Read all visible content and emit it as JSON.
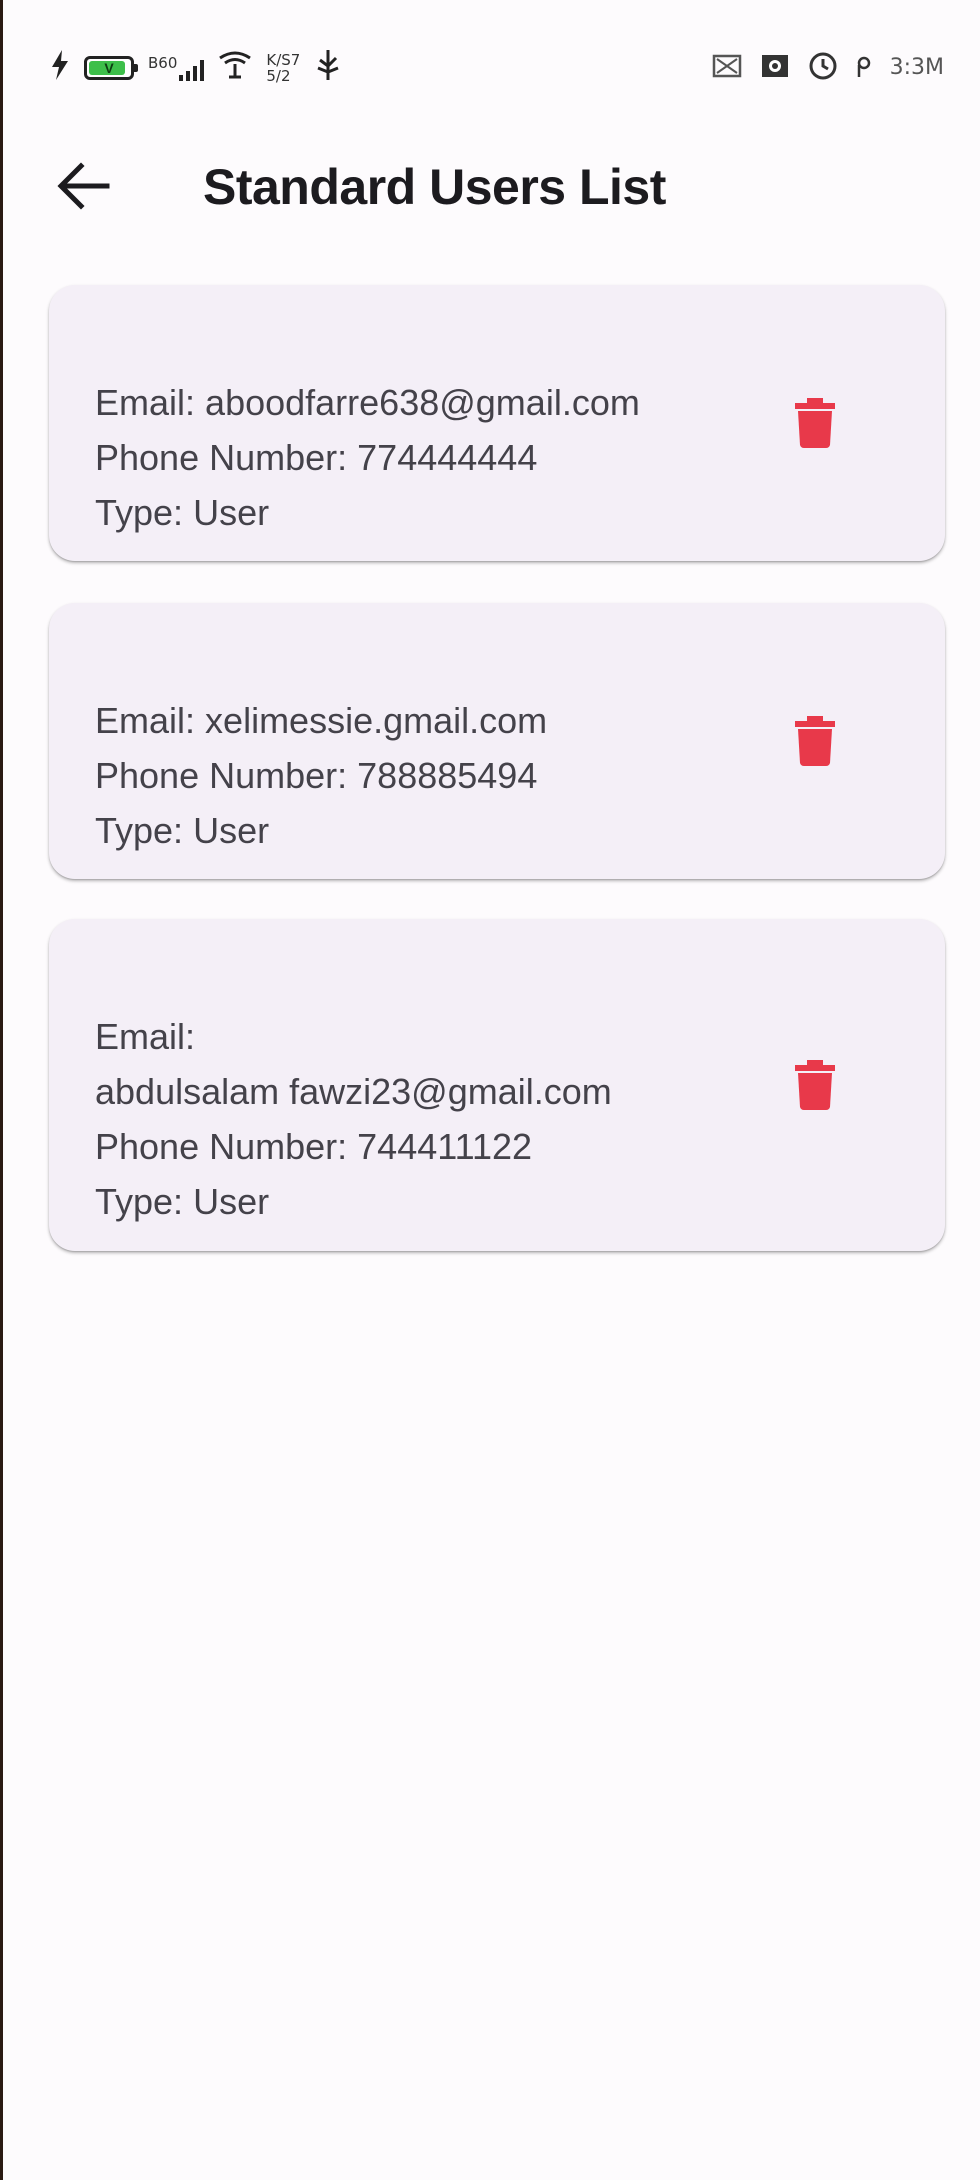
{
  "colors": {
    "background": "#fdfbfd",
    "card_background": "#f4eff7",
    "delete_icon": "#e8394a",
    "title_text": "#1c1b1f",
    "body_text": "#44424a",
    "battery_fill": "#3dbf4a"
  },
  "status_bar": {
    "left_icons": [
      "charging-bolt-icon",
      "battery-icon",
      "signal-icon",
      "wifi-icon",
      "data-speed-icon",
      "usb-icon"
    ],
    "battery_label": "V",
    "battery_level": 0.9,
    "network_label": "B60",
    "speed_top": "K/S7",
    "speed_bottom": "5/2",
    "right_icons": [
      "notification-icon",
      "screenshot-icon",
      "clock-icon",
      "pin-icon"
    ],
    "time": "3:3M"
  },
  "app_bar": {
    "back_icon": "arrow-left-icon",
    "title": "Standard Users List"
  },
  "users": [
    {
      "email_label": "Email:",
      "email": "aboodfarre638@gmail.com",
      "phone_label": "Phone Number:",
      "phone": "774444444",
      "type_label": "Type:",
      "type": "User",
      "delete_icon": "trash-icon"
    },
    {
      "email_label": "Email:",
      "email": "xelimessie.gmail.com",
      "phone_label": "Phone Number:",
      "phone": "788885494",
      "type_label": "Type:",
      "type": "User",
      "delete_icon": "trash-icon"
    },
    {
      "email_label": "Email:",
      "email": "abdulsalam fawzi23@gmail.com",
      "phone_label": "Phone Number:",
      "phone": "744411122",
      "type_label": "Type:",
      "type": "User",
      "delete_icon": "trash-icon"
    }
  ]
}
